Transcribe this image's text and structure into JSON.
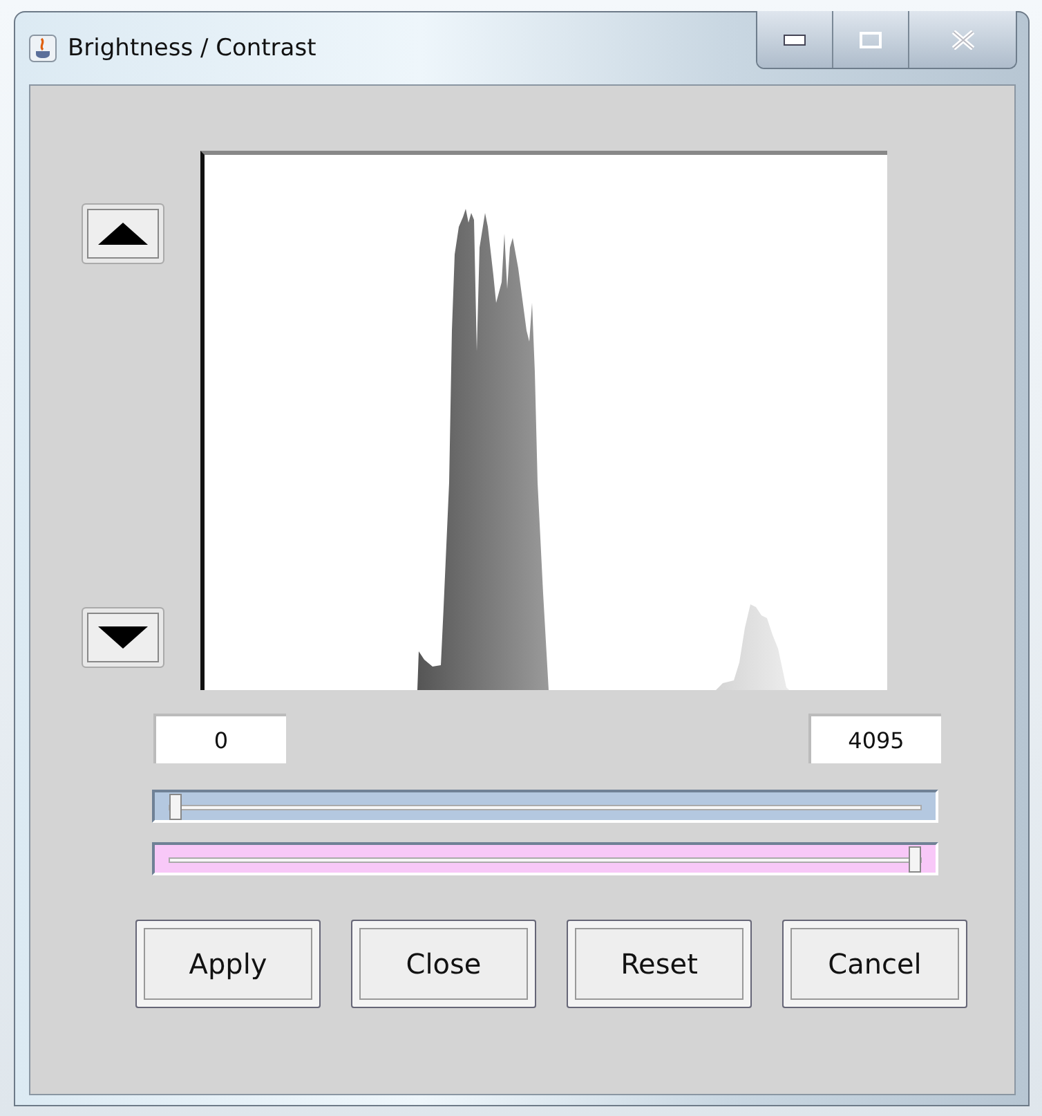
{
  "window": {
    "title": "Brightness / Contrast"
  },
  "range": {
    "minimum": "0",
    "maximum": "4095"
  },
  "sliders": [
    {
      "level": 0.02,
      "color": "#b4c8e0"
    },
    {
      "level": 0.98,
      "color": "#f8c8f8"
    }
  ],
  "buttons": [
    "Apply",
    "Close",
    "Reset",
    "Cancel"
  ]
}
